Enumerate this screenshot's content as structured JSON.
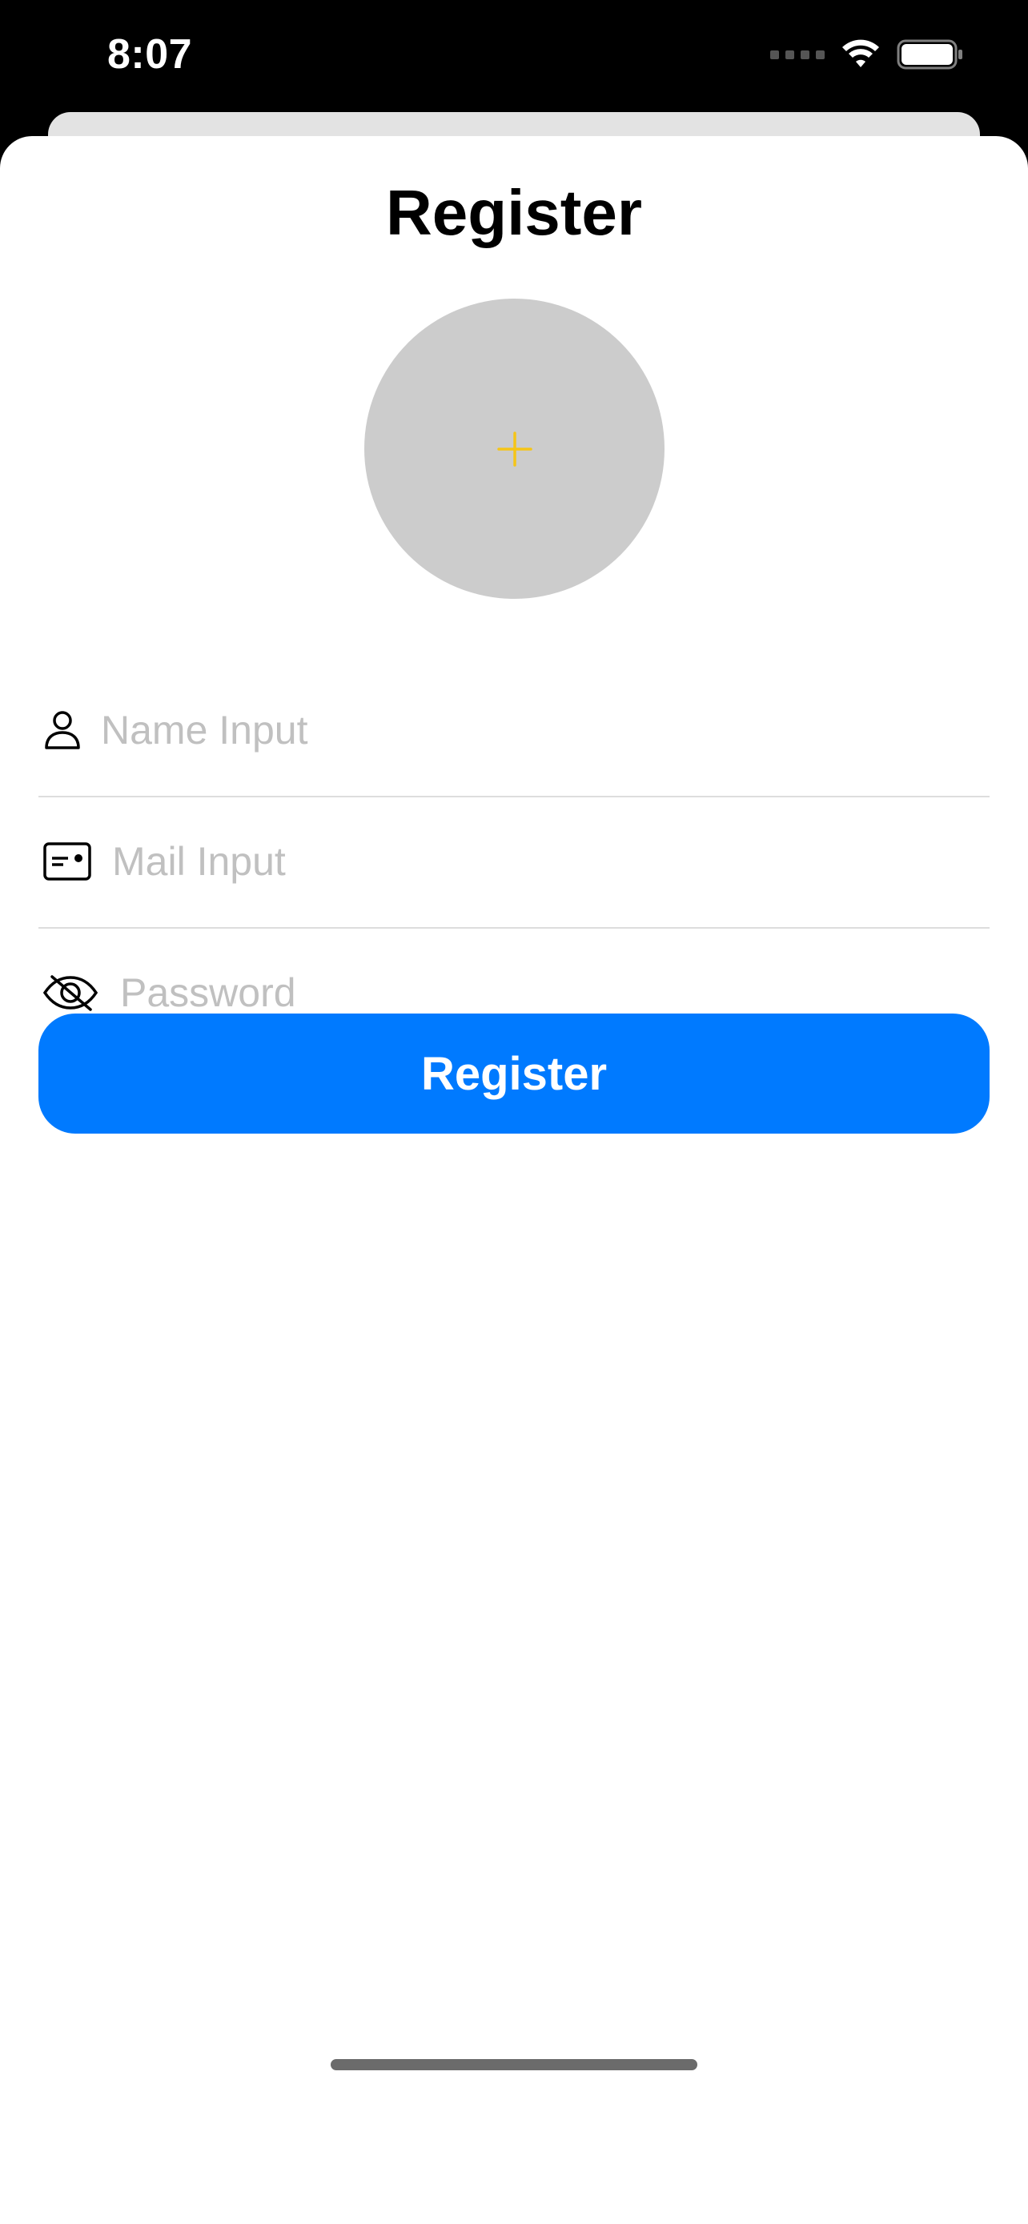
{
  "status_bar": {
    "time": "8:07",
    "icons": [
      "signal-dots-icon",
      "wifi-icon",
      "battery-icon"
    ]
  },
  "page": {
    "title": "Register"
  },
  "avatar": {
    "icon": "plus-icon",
    "plus_color": "#f5c518",
    "background": "#cccccc"
  },
  "form": {
    "name": {
      "icon": "person-icon",
      "value": "",
      "placeholder": "Name Input"
    },
    "mail": {
      "icon": "id-card-icon",
      "value": "",
      "placeholder": "Mail Input"
    },
    "password": {
      "icon": "eye-slash-icon",
      "value": "",
      "placeholder": "Password"
    }
  },
  "register_button": {
    "label": "Register",
    "color": "#007aff"
  }
}
